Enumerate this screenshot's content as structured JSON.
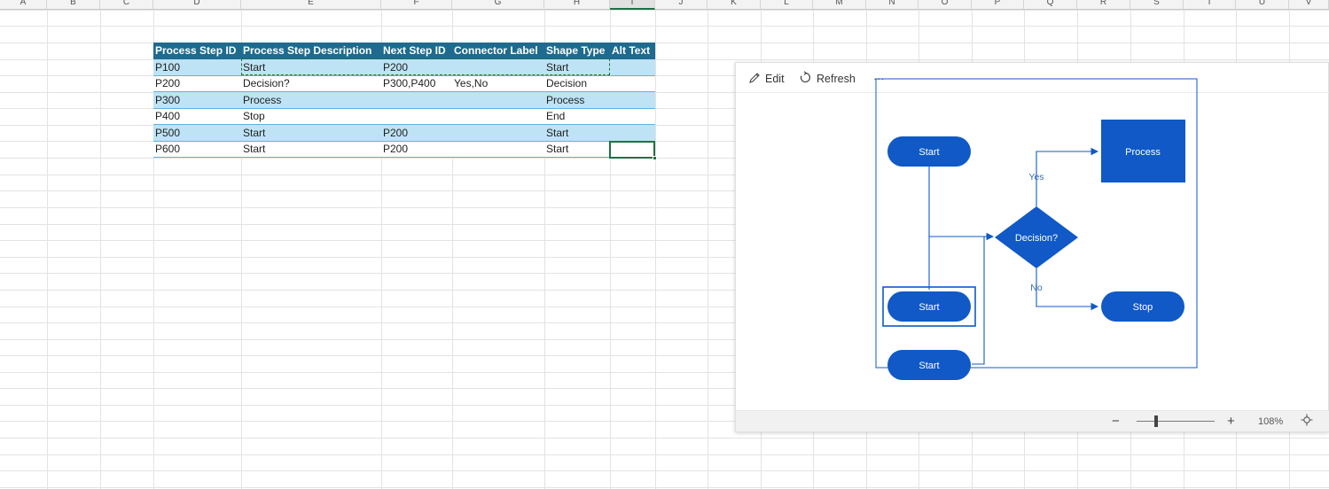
{
  "columns": [
    "A",
    "B",
    "C",
    "D",
    "E",
    "F",
    "G",
    "H",
    "I",
    "J",
    "K",
    "L",
    "M",
    "N",
    "O",
    "P",
    "Q",
    "R",
    "S",
    "T",
    "U",
    "V"
  ],
  "table": {
    "headers": [
      "Process Step ID",
      "Process Step Description",
      "Next Step ID",
      "Connector Label",
      "Shape Type",
      "Alt Text"
    ],
    "rows": [
      [
        "P100",
        "Start",
        "P200",
        "",
        "Start",
        ""
      ],
      [
        "P200",
        "Decision?",
        "P300,P400",
        "Yes,No",
        "Decision",
        ""
      ],
      [
        "P300",
        "Process",
        "",
        "",
        "Process",
        ""
      ],
      [
        "P400",
        "Stop",
        "",
        "",
        "End",
        ""
      ],
      [
        "P500",
        "Start",
        "P200",
        "",
        "Start",
        ""
      ],
      [
        "P600",
        "Start",
        "P200",
        "",
        "Start",
        ""
      ]
    ]
  },
  "panel": {
    "edit_label": "Edit",
    "refresh_label": "Refresh",
    "more_label": "···",
    "zoom_out": "−",
    "zoom_in": "+",
    "zoom_level": "108%",
    "zoom_fraction": 0.25
  },
  "diagram": {
    "nodes": {
      "start1": "Start",
      "start2": "Start",
      "start3": "Start",
      "decision": "Decision?",
      "process": "Process",
      "stop": "Stop"
    },
    "edge_yes": "Yes",
    "edge_no": "No"
  },
  "colors": {
    "shape_fill": "#1059c6",
    "connector": "#1059c6",
    "table_header": "#1e6b8f",
    "table_band": "#bee3f4",
    "selection": "#1e7145"
  }
}
